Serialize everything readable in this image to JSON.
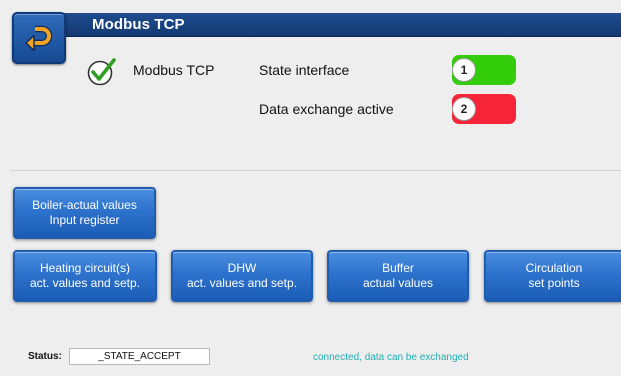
{
  "header": {
    "title": "Modbus TCP",
    "back_icon": "return-arrow-icon"
  },
  "panel": {
    "check_icon": "checkmark-circle-icon",
    "protocol_label": "Modbus TCP",
    "rows": [
      {
        "number": "1",
        "label": "State interface",
        "state_color": "#33cc0a"
      },
      {
        "number": "2",
        "label": "Data exchange active",
        "state_color": "#f52437"
      }
    ]
  },
  "buttons": {
    "boiler": [
      "Boiler-actual values",
      "Input register"
    ],
    "heating": [
      "Heating circuit(s)",
      "act. values and setp."
    ],
    "dhw": [
      "DHW",
      "act. values and setp."
    ],
    "buffer": [
      "Buffer",
      "actual values"
    ],
    "circulation": [
      "Circulation",
      "set points"
    ]
  },
  "status": {
    "label": "Status:",
    "value": "_STATE_ACCEPT",
    "message": "connected, data can be exchanged"
  },
  "colors": {
    "header_blue": "#1a4483",
    "button_blue": "#2d72cc",
    "status_message": "#22b0b3"
  }
}
